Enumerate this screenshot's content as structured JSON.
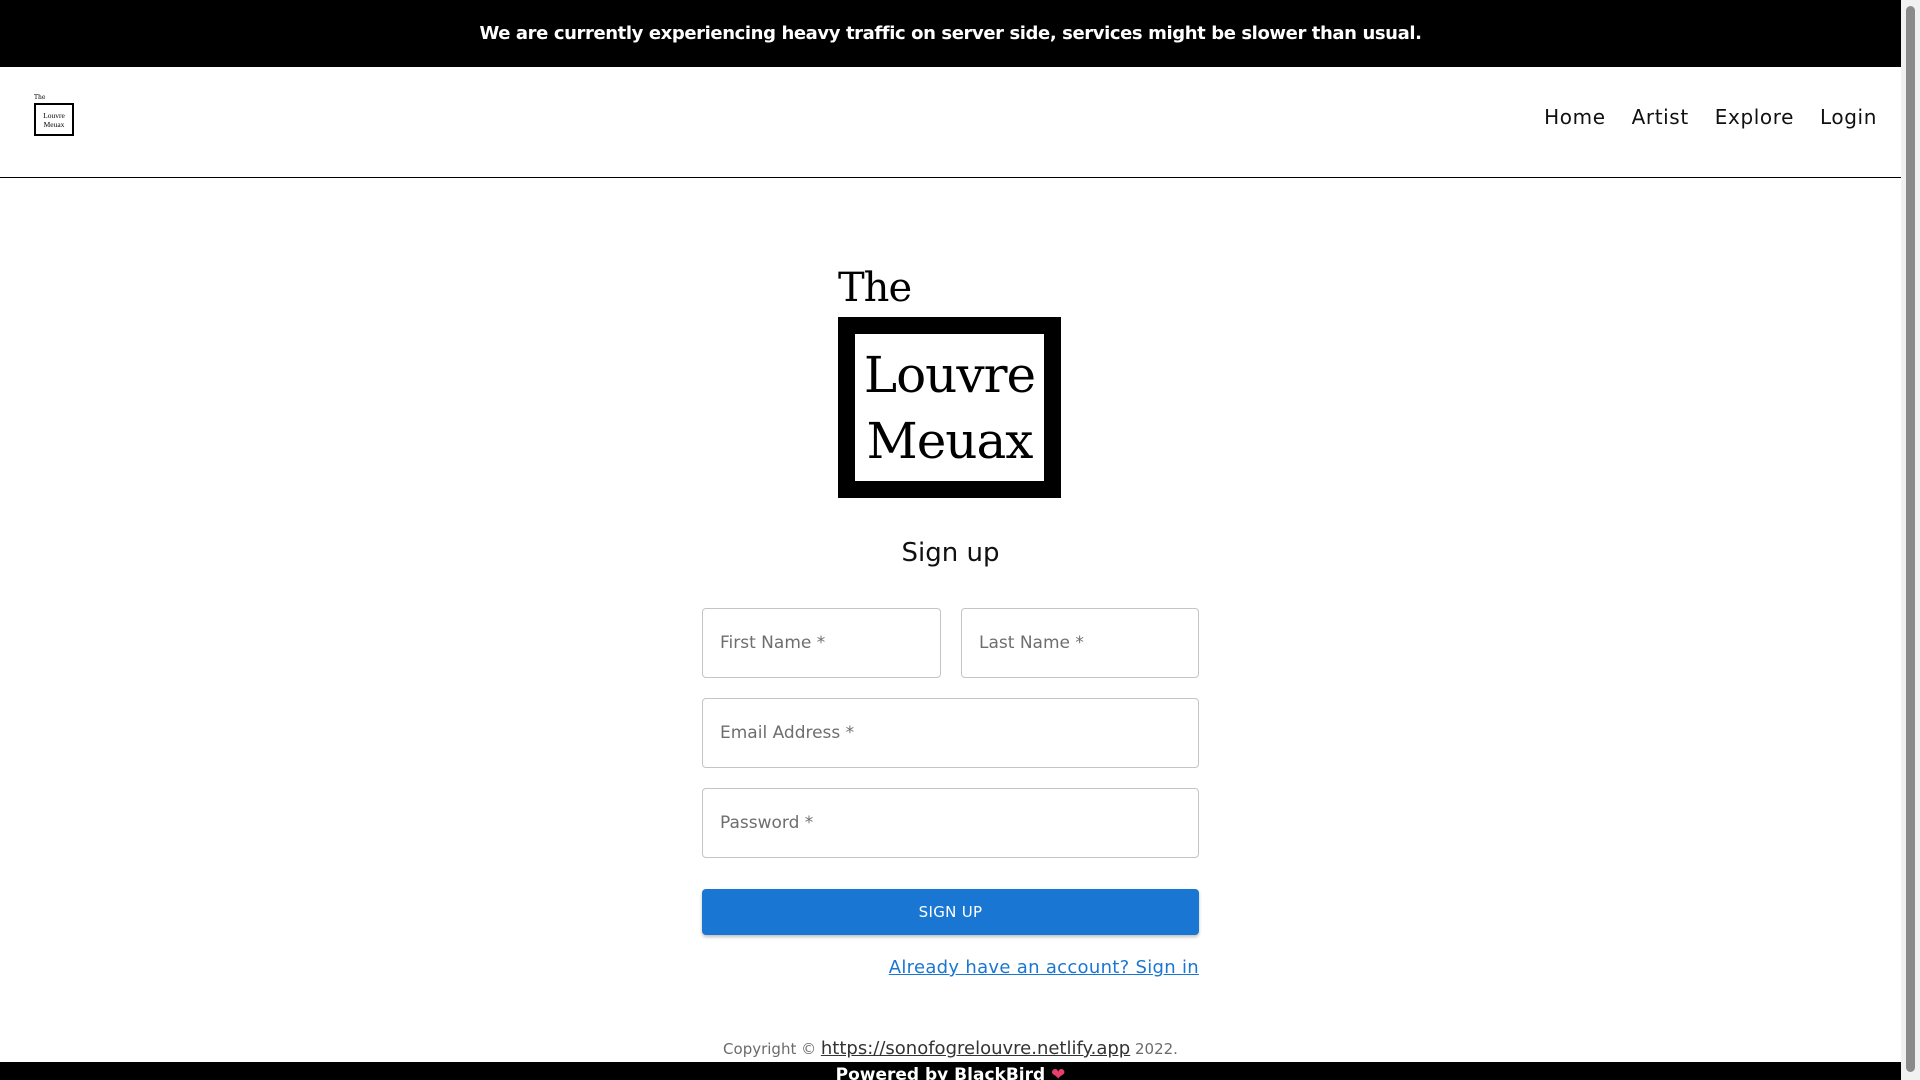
{
  "announcement": {
    "text": "We are currently experiencing heavy traffic on server side, services might be slower than usual."
  },
  "header": {
    "logo": {
      "the": "The",
      "line1": "Louvre",
      "line2": "Meuax"
    },
    "nav": [
      {
        "label": "Home"
      },
      {
        "label": "Artist"
      },
      {
        "label": "Explore"
      },
      {
        "label": "Login"
      }
    ]
  },
  "brand": {
    "the": "The",
    "line1": "Louvre",
    "line2": "Meuax"
  },
  "form": {
    "title": "Sign up",
    "first_name": {
      "placeholder": "First Name *",
      "value": ""
    },
    "last_name": {
      "placeholder": "Last Name *",
      "value": ""
    },
    "email": {
      "placeholder": "Email Address *",
      "value": ""
    },
    "password": {
      "placeholder": "Password *",
      "value": ""
    },
    "submit_label": "SIGN UP",
    "signin_link": "Already have an account? Sign in"
  },
  "copyright": {
    "prefix": "Copyright ©",
    "link": "https://sonofogrelouvre.netlify.app",
    "suffix": "2022."
  },
  "footer": {
    "text": "Powered by BlackBird",
    "icon": "heart-icon"
  },
  "colors": {
    "primary": "#1976d2",
    "bar": "#000000"
  }
}
